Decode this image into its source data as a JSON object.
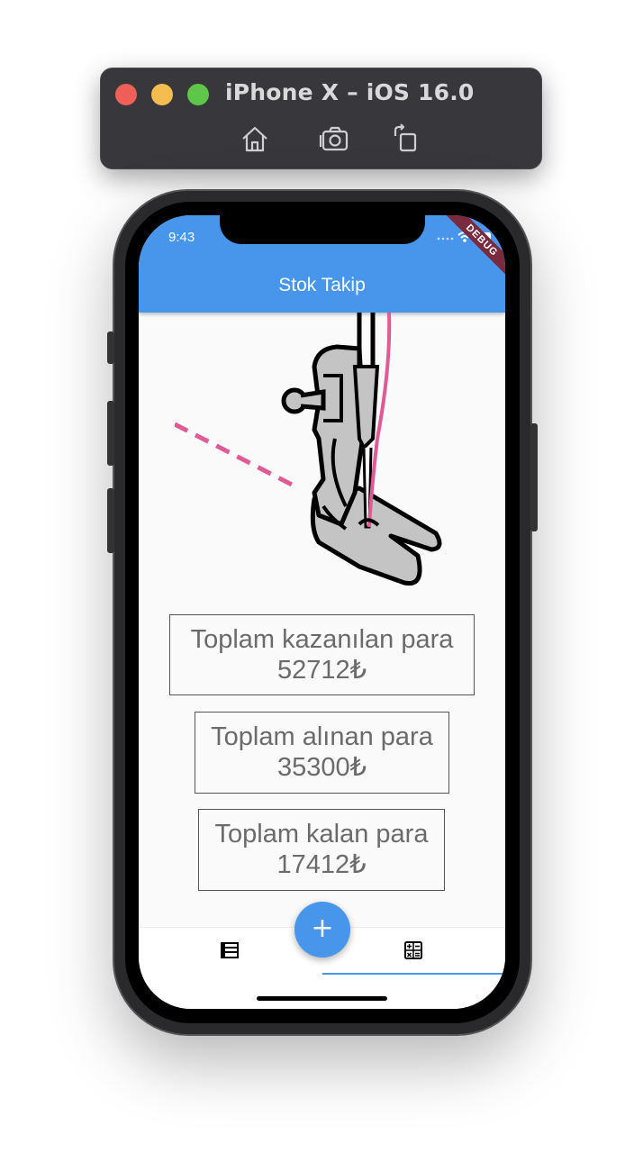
{
  "simulator": {
    "title": "iPhone X – iOS 16.0",
    "icons": [
      "home-icon",
      "screenshot-icon",
      "rotate-icon"
    ]
  },
  "status_bar": {
    "time": "9:43"
  },
  "debug_banner": "DEBUG",
  "app_bar": {
    "title": "Stok Takip",
    "color": "#4796eb"
  },
  "stats": [
    {
      "label": "Toplam kazanılan para",
      "value": "52712₺"
    },
    {
      "label": "Toplam alınan para",
      "value": "35300₺"
    },
    {
      "label": "Toplam kalan para",
      "value": "17412₺"
    }
  ],
  "fab": {
    "label": "+",
    "icon": "add-icon"
  },
  "bottom_nav": {
    "items": [
      {
        "icon": "list-icon",
        "selected": false
      },
      {
        "icon": "calculator-icon",
        "selected": true
      }
    ]
  }
}
